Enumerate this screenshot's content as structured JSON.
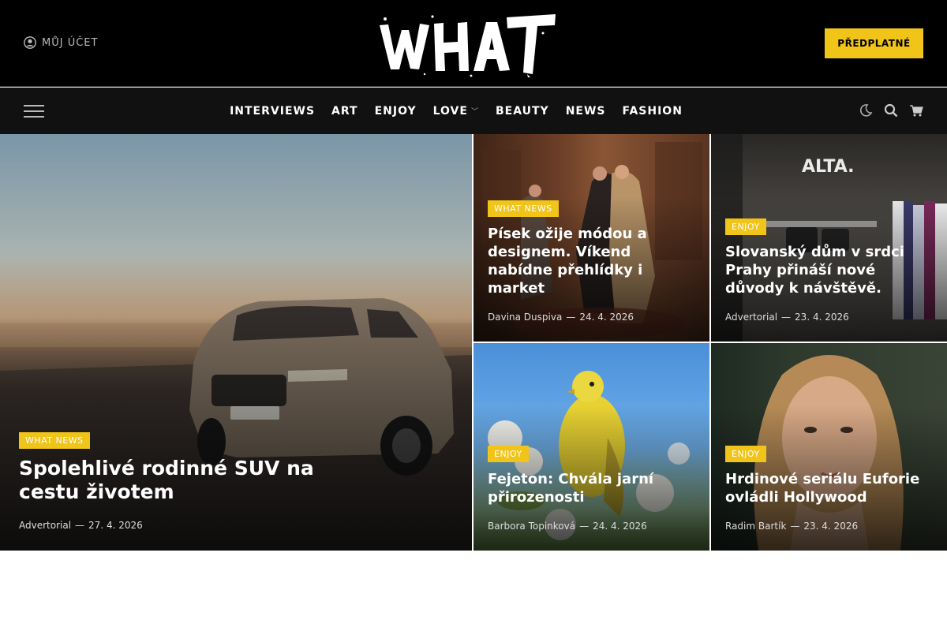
{
  "header": {
    "account_label": "MŮJ ÚČET",
    "logo_text": "WHAT",
    "subscribe_label": "PŘEDPLATNÉ",
    "accent_color": "#f0c419"
  },
  "nav": {
    "items": [
      {
        "label": "INTERVIEWS"
      },
      {
        "label": "ART"
      },
      {
        "label": "ENJOY"
      },
      {
        "label": "LOVE",
        "has_dropdown": true
      },
      {
        "label": "BEAUTY"
      },
      {
        "label": "NEWS"
      },
      {
        "label": "FASHION"
      }
    ],
    "icons": [
      "menu-icon",
      "moon-icon",
      "search-icon",
      "cart-icon"
    ]
  },
  "articles": {
    "main": {
      "category": "WHAT NEWS",
      "title": "Spolehlivé rodinné SUV na cestu životem",
      "author": "Advertorial",
      "date": "27. 4. 2026",
      "image": "car-photo"
    },
    "a1": {
      "category": "WHAT NEWS",
      "title": "Písek ožije módou a designem. Víkend nabídne přehlídky i market",
      "author": "Davina Duspiva",
      "date": "24. 4. 2026",
      "image": "fashion-photo"
    },
    "a2": {
      "category": "ENJOY",
      "title": "Slovanský dům v srdci Prahy přináší nové důvody k návštěvě.",
      "author": "Advertorial",
      "date": "23. 4. 2026",
      "image": "store-photo"
    },
    "a3": {
      "category": "ENJOY",
      "title": "Fejeton: Chvála jarní přirozenosti",
      "author": "Barbora Topinková",
      "date": "24. 4. 2026",
      "image": "bird-photo"
    },
    "a4": {
      "category": "ENJOY",
      "title": "Hrdinové seriálu Euforie ovládli Hollywood",
      "author": "Radim Bartík",
      "date": "23. 4. 2026",
      "image": "portrait-photo"
    }
  }
}
